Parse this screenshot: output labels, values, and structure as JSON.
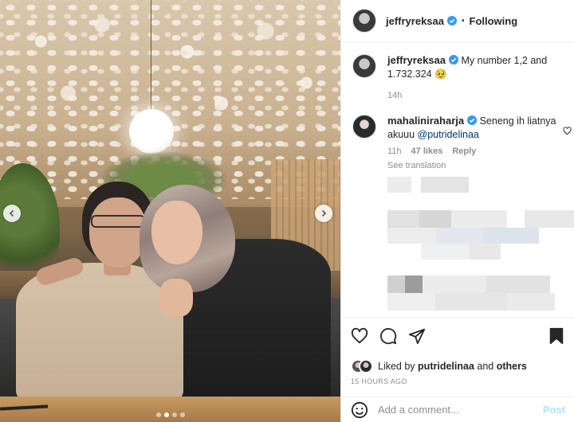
{
  "header": {
    "username": "jeffryreksaa",
    "separator": "•",
    "follow_status": "Following"
  },
  "caption": {
    "username": "jeffryreksaa",
    "text": "My number 1,2 and 1.732.324 🥹",
    "time": "14h"
  },
  "comments": [
    {
      "username": "mahaliniraharja",
      "text_prefix": "Seneng ih liatnya akuuu ",
      "mention": "@putridelinaa",
      "time": "11h",
      "likes": "47 likes",
      "reply": "Reply",
      "translation": "See translation"
    }
  ],
  "liked_by": {
    "prefix": "Liked by",
    "user": "putridelinaa",
    "middle": "and",
    "others": "others"
  },
  "post_time": "15 HOURS AGO",
  "add_comment": {
    "placeholder": "Add a comment...",
    "post_label": "Post"
  },
  "carousel": {
    "count": 4,
    "active_index": 1
  },
  "colors": {
    "verified": "#3897f0",
    "link": "#00376b",
    "muted": "#8e8e8e",
    "post_disabled": "#b2dffc"
  },
  "icons": {
    "like": "heart-icon",
    "comment": "comment-icon",
    "share": "paper-plane-icon",
    "save": "bookmark-icon",
    "emoji": "emoji-icon",
    "verified": "verified-badge-icon"
  }
}
